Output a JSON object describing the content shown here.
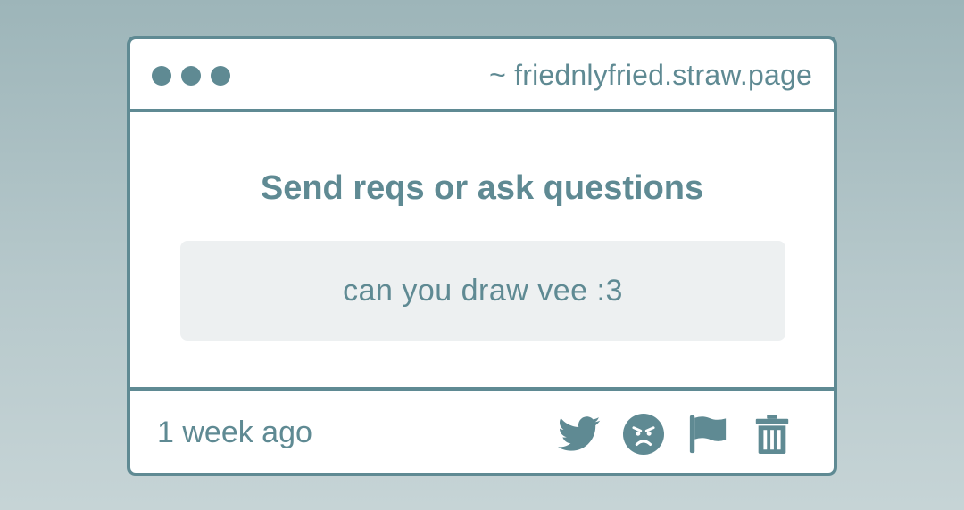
{
  "window": {
    "url": "~ friednlyfried.straw.page"
  },
  "prompt": {
    "title": "Send reqs or ask questions"
  },
  "message": {
    "text": "can you draw vee :3"
  },
  "footer": {
    "timestamp": "1 week ago",
    "actions": [
      {
        "name": "share-twitter",
        "icon": "twitter-bird-icon"
      },
      {
        "name": "react-angry",
        "icon": "angry-face-icon"
      },
      {
        "name": "report",
        "icon": "flag-icon"
      },
      {
        "name": "delete",
        "icon": "trash-icon"
      }
    ]
  },
  "colors": {
    "accent": "#5f8a93",
    "message_bg": "#edf0f1",
    "card_bg": "#ffffff"
  }
}
